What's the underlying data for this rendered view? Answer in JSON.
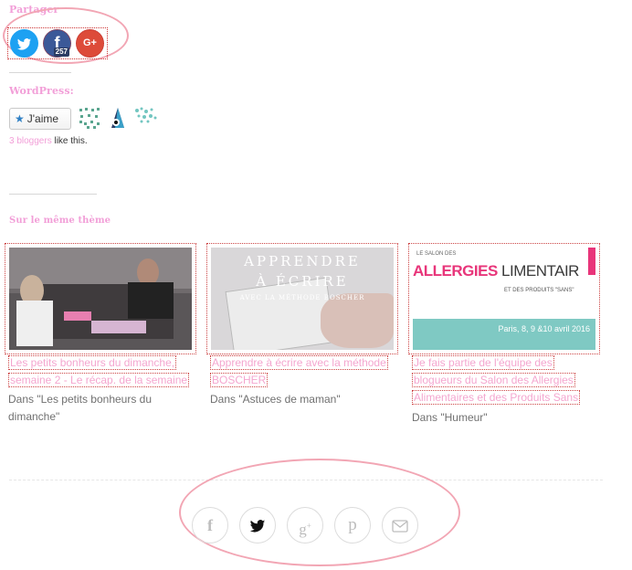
{
  "share": {
    "title": "Partager",
    "buttons": [
      {
        "network": "twitter",
        "icon": "twitter-icon",
        "color": "#1da1f2"
      },
      {
        "network": "facebook",
        "icon": "facebook-icon",
        "color": "#3b5998",
        "count": "257"
      },
      {
        "network": "google-plus",
        "icon": "google-plus-icon",
        "color": "#dd4b39",
        "label": "G+"
      }
    ]
  },
  "wordpress": {
    "title": "WordPress:",
    "like_label": "J'aime",
    "bloggers_link": "3 bloggers",
    "bloggers_rest": " like this."
  },
  "related": {
    "title": "Sur le même thème",
    "items": [
      {
        "title": "Les petits bonheurs du dimanche, semaine 2 - Le récap. de la semaine",
        "category": "Dans \"Les petits bonheurs du dimanche\""
      },
      {
        "title": "Apprendre à écrire avec la méthode BOSCHER",
        "category": "Dans \"Astuces de maman\"",
        "image_text": [
          "APPRENDRE",
          "À ÉCRIRE",
          "AVEC LA MÉTHODE BOSCHER"
        ]
      },
      {
        "title": "Je fais partie de l'équipe des blogueurs du Salon des Allergies Alimentaires et des Produits Sans",
        "category": "Dans \"Humeur\"",
        "image_text": [
          "LE SALON DES",
          "ALLERGIES",
          "LIMENTAIR",
          "ET DES PRODUITS \"SANS\"",
          "Paris, 8, 9 &10 avril 2016"
        ]
      }
    ]
  },
  "footer_social": [
    {
      "icon": "facebook-icon",
      "glyph": "f",
      "active": false
    },
    {
      "icon": "twitter-icon",
      "glyph": "🐦",
      "active": true
    },
    {
      "icon": "google-plus-icon",
      "glyph": "g+",
      "active": false
    },
    {
      "icon": "pinterest-icon",
      "glyph": "p",
      "active": false
    },
    {
      "icon": "mail-icon",
      "glyph": "✉",
      "active": false
    }
  ],
  "colors": {
    "accent_pink": "#f29fd8",
    "annotation_oval": "#f2a6b4",
    "twitter": "#1da1f2",
    "facebook": "#3b5998",
    "google_plus": "#dd4b39"
  }
}
